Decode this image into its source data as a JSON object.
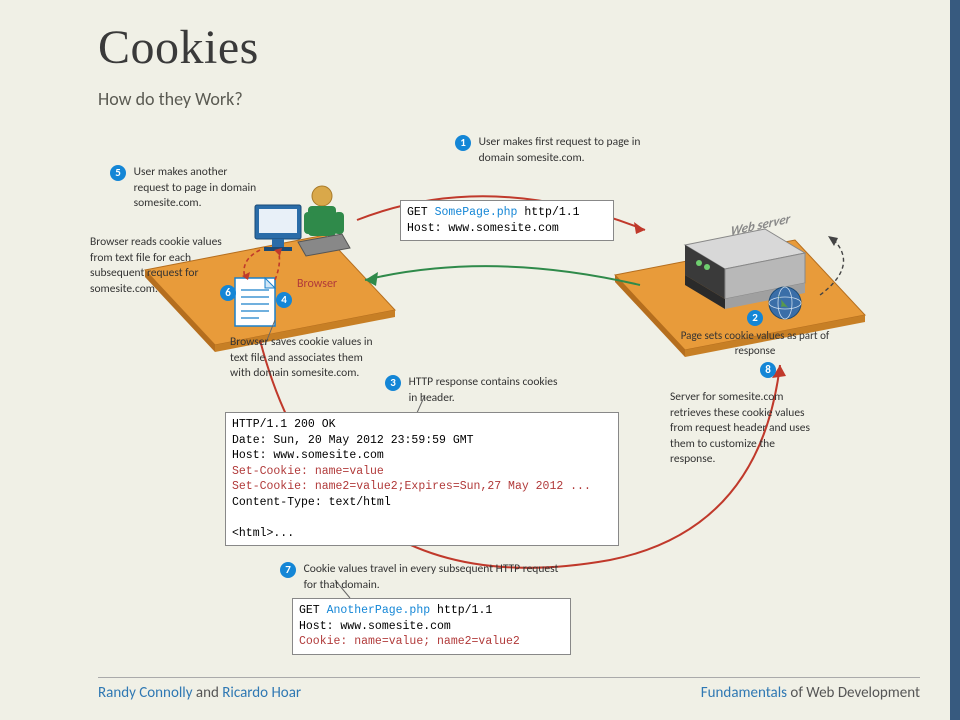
{
  "title": "Cookies",
  "subtitle": "How do they Work?",
  "steps": {
    "s1": "User makes first request to page in  domain somesite.com.",
    "s2": "Page sets cookie values as part of response",
    "s3": "HTTP response contains cookies in header.",
    "s4_line": "Browser saves cookie values in text file and associates them with domain somesite.com.",
    "s5": "User makes another request to page in domain somesite.com.",
    "s6": "Browser reads cookie values from text file for each subsequent request for somesite.com.",
    "s7": "Cookie values travel in every subsequent HTTP request for that domain.",
    "s8": "Server for somesite.com retrieves these cookie values from request header and uses them to customize the response."
  },
  "labels": {
    "browser": "Browser",
    "webserver": "Web server"
  },
  "code": {
    "req1": {
      "line1": "GET ",
      "file": "SomePage.php",
      "proto": " http/1.1",
      "host": "Host: www.somesite.com"
    },
    "resp": {
      "l1": "HTTP/1.1 200 OK",
      "l2": "Date: Sun, 20 May 2012 23:59:59 GMT",
      "l3": "Host: www.somesite.com",
      "l4": "Set-Cookie: name=value",
      "l5": "Set-Cookie: name2=value2;Expires=Sun,27 May 2012 ...",
      "l6": "Content-Type: text/html",
      "l7": "",
      "l8": "<html>..."
    },
    "req2": {
      "line1": "GET ",
      "file": "AnotherPage.php",
      "proto": " http/1.1",
      "host": "Host: www.somesite.com",
      "cookie": "Cookie: name=value; name2=value2"
    }
  },
  "footer": {
    "author1": "Randy Connolly",
    "and": " and ",
    "author2": "Ricardo Hoar",
    "book1": "Fundamentals",
    "book2": " of Web Development"
  }
}
